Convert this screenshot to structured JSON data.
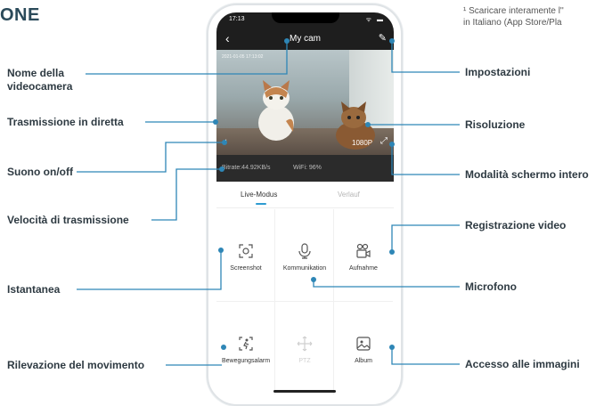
{
  "heading": "ONE",
  "footnote": [
    "¹ Scaricare interamente l''",
    "in Italiano (App Store/Pla"
  ],
  "labels": {
    "camera_name": [
      "Nome della",
      "videocamera"
    ],
    "live": "Trasmissione in diretta",
    "sound": "Suono on/off",
    "speed": "Velocità di trasmissione",
    "snapshot": "Istantanea",
    "motion": "Rilevazione del movimento",
    "settings": "Impostazioni",
    "resolution": "Risoluzione",
    "fullscreen": "Modalità schermo intero",
    "record": "Registrazione video",
    "mic": "Microfono",
    "images": "Accesso alle immagini"
  },
  "phone": {
    "status_time": "17:13",
    "status_icons": "ᯤ ▬",
    "back_icon": "chevron-left-icon",
    "title": "My cam",
    "edit_icon": "pencil-icon",
    "video_timestamp": "2021-01-05  17:13:02",
    "resolution": "1080P",
    "bitrate": "Bitrate:44.92KB/s",
    "wifi": "WiFi: 96%",
    "tabs": [
      "Live-Modus",
      "Verlauf"
    ],
    "actions": [
      {
        "label": "Screenshot",
        "icon": "screenshot-icon",
        "enabled": true
      },
      {
        "label": "Kommunikation",
        "icon": "microphone-icon",
        "enabled": true
      },
      {
        "label": "Aufnahme",
        "icon": "video-record-icon",
        "enabled": true
      },
      {
        "label": "Bewegungsalarm",
        "icon": "motion-icon",
        "enabled": true
      },
      {
        "label": "PTZ",
        "icon": "ptz-icon",
        "enabled": false
      },
      {
        "label": "Album",
        "icon": "album-icon",
        "enabled": true
      }
    ]
  },
  "colors": {
    "accent": "#2e9bd1",
    "callout": "#2e86b6",
    "dark": "#1e1e1e"
  }
}
